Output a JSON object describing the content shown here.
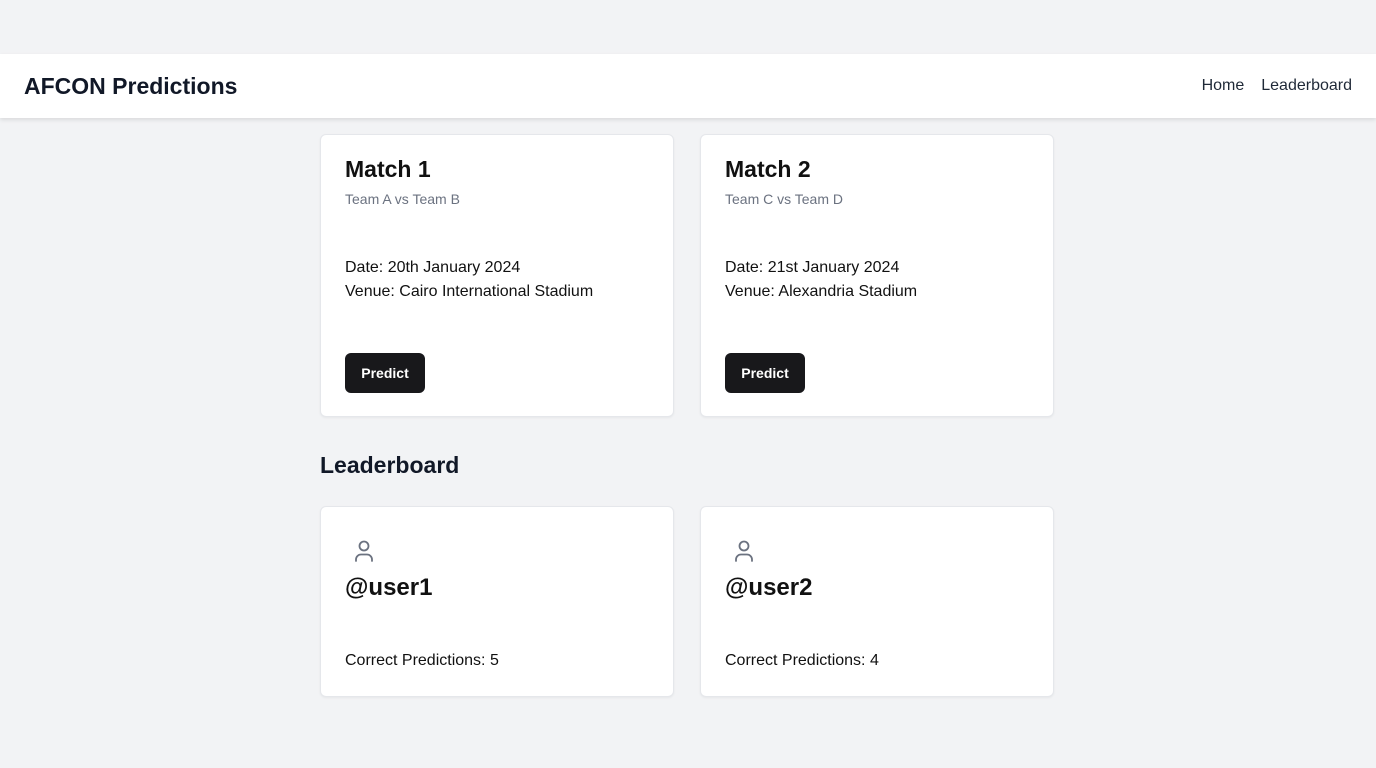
{
  "navbar": {
    "brand": "AFCON Predictions",
    "links": [
      "Home",
      "Leaderboard"
    ]
  },
  "matches": [
    {
      "title": "Match 1",
      "teams": "Team A vs Team B",
      "date": "Date: 20th January 2024",
      "venue": "Venue: Cairo International Stadium",
      "button": "Predict"
    },
    {
      "title": "Match 2",
      "teams": "Team C vs Team D",
      "date": "Date: 21st January 2024",
      "venue": "Venue: Alexandria Stadium",
      "button": "Predict"
    }
  ],
  "leaderboard": {
    "title": "Leaderboard",
    "users": [
      {
        "handle": "@user1",
        "stat": "Correct Predictions: 5",
        "icon": "user-icon"
      },
      {
        "handle": "@user2",
        "stat": "Correct Predictions: 4",
        "icon": "user-icon"
      }
    ]
  },
  "colors": {
    "background": "#f2f3f5",
    "card": "#ffffff",
    "button": "#18181b",
    "muted_text": "#6b7280"
  }
}
